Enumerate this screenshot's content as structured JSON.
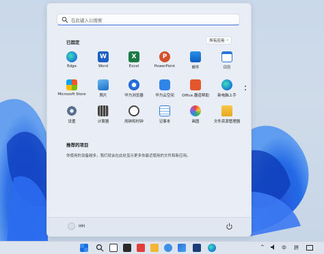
{
  "search": {
    "placeholder": "在此键入以搜索"
  },
  "pinned": {
    "title": "已固定",
    "all_apps_label": "所有应用",
    "apps": [
      {
        "label": "Edge",
        "icon": "edge-icon"
      },
      {
        "label": "Word",
        "icon": "word-icon"
      },
      {
        "label": "Excel",
        "icon": "excel-icon"
      },
      {
        "label": "PowerPoint",
        "icon": "powerpoint-icon"
      },
      {
        "label": "邮件",
        "icon": "mail-icon"
      },
      {
        "label": "日历",
        "icon": "calendar-icon"
      },
      {
        "label": "Microsoft Store",
        "icon": "store-icon"
      },
      {
        "label": "照片",
        "icon": "photos-icon"
      },
      {
        "label": "华为浏览器",
        "icon": "huawei-browser-icon"
      },
      {
        "label": "华为云空间",
        "icon": "huawei-cloud-icon"
      },
      {
        "label": "Office 趣道帮助",
        "icon": "office-help-icon"
      },
      {
        "label": "新电脑上手",
        "icon": "new-pc-icon"
      },
      {
        "label": "设置",
        "icon": "settings-icon"
      },
      {
        "label": "计算器",
        "icon": "calculator-icon"
      },
      {
        "label": "闹钟和时钟",
        "icon": "alarm-clock-icon"
      },
      {
        "label": "记事本",
        "icon": "notepad-icon"
      },
      {
        "label": "画图",
        "icon": "paint-icon"
      },
      {
        "label": "文件资源管理器",
        "icon": "file-explorer-icon"
      }
    ]
  },
  "recommended": {
    "title": "推荐的项目",
    "text": "你使用的设备越多，我们就会在此处显示更多你最近使用的文件和新应用。"
  },
  "footer": {
    "user_name": "HH"
  },
  "taskbar": {
    "tray_ime": "中",
    "tray_layout": "拼"
  },
  "colors": {
    "accent": "#3a6fd8",
    "start_bg": "#e9eef6"
  }
}
